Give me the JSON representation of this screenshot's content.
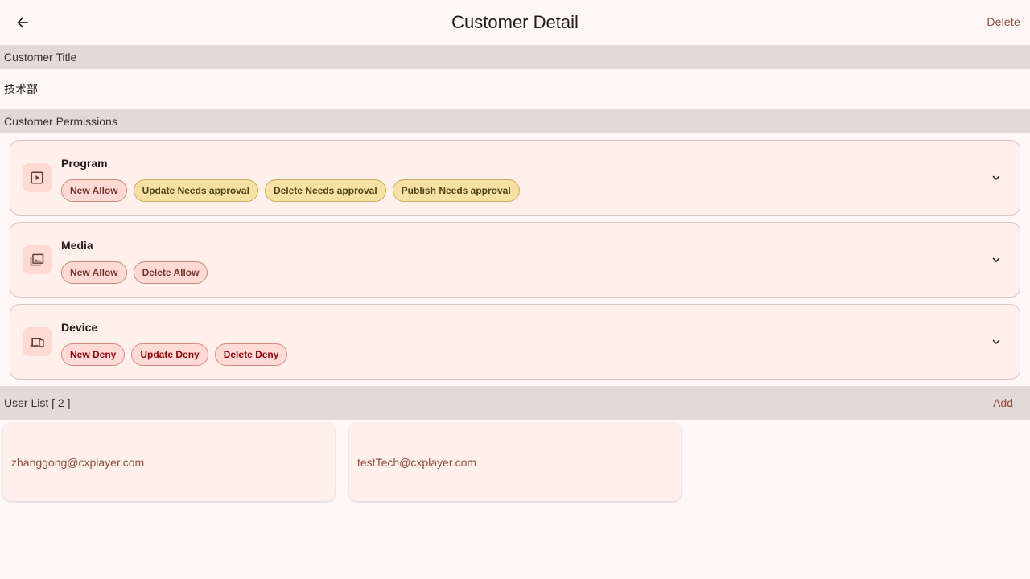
{
  "appbar": {
    "title": "Customer Detail",
    "delete_label": "Delete"
  },
  "customer_title": {
    "header": "Customer Title",
    "value": "技术部"
  },
  "permissions": {
    "header": "Customer Permissions",
    "items": [
      {
        "name": "Program",
        "icon": "play-icon",
        "chips": [
          {
            "label": "New Allow",
            "kind": "allow"
          },
          {
            "label": "Update Needs approval",
            "kind": "approval"
          },
          {
            "label": "Delete Needs approval",
            "kind": "approval"
          },
          {
            "label": "Publish Needs approval",
            "kind": "approval"
          }
        ]
      },
      {
        "name": "Media",
        "icon": "photo-library-icon",
        "chips": [
          {
            "label": "New Allow",
            "kind": "allow"
          },
          {
            "label": "Delete Allow",
            "kind": "allow"
          }
        ]
      },
      {
        "name": "Device",
        "icon": "devices-icon",
        "chips": [
          {
            "label": "New Deny",
            "kind": "deny"
          },
          {
            "label": "Update Deny",
            "kind": "deny"
          },
          {
            "label": "Delete Deny",
            "kind": "deny"
          }
        ]
      }
    ]
  },
  "users": {
    "header": "User List [ 2 ]",
    "add_label": "Add",
    "items": [
      "zhanggong@cxplayer.com",
      "testTech@cxplayer.com"
    ]
  },
  "colors": {
    "accent": "#904a42",
    "background": "#fff8f6",
    "section": "#e2dad9"
  }
}
